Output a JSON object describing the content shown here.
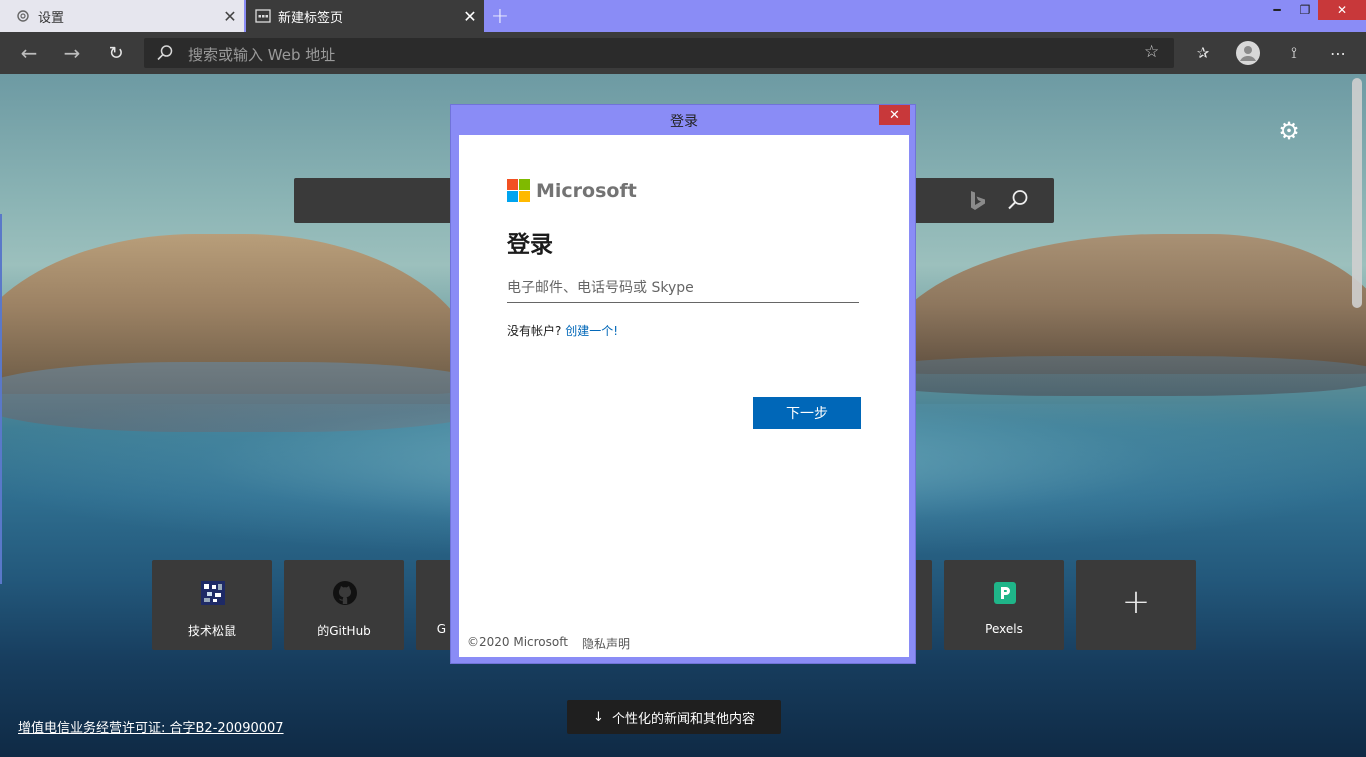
{
  "tabs": [
    {
      "title": "设置",
      "icon": "gear-icon",
      "active": false
    },
    {
      "title": "新建标签页",
      "icon": "newtab-icon",
      "active": true
    }
  ],
  "toolbar": {
    "address_placeholder": "搜索或输入 Web 地址"
  },
  "newtab": {
    "tiles": [
      {
        "label": "技术松鼠",
        "icon": "site-logo-icon"
      },
      {
        "label": "的GitHub",
        "icon": "github-icon"
      },
      {
        "label": "G",
        "icon": ""
      },
      {
        "label": "Pexels",
        "icon": "pexels-icon"
      }
    ],
    "license_text": "增值电信业务经营许可证: 合字B2-20090007",
    "news_button": "个性化的新闻和其他内容"
  },
  "dialog": {
    "title": "登录",
    "brand": "Microsoft",
    "heading": "登录",
    "email_placeholder": "电子邮件、电话号码或 Skype",
    "no_account": "没有帐户?",
    "create_account": "创建一个!",
    "next_button": "下一步",
    "copyright": "©2020 Microsoft",
    "privacy": "隐私声明"
  },
  "colors": {
    "tabstrip": "#8a8cf6",
    "accent": "#0067b8",
    "close_red": "#c8383a",
    "ms_red": "#f25022",
    "ms_green": "#7fba00",
    "ms_blue": "#00a4ef",
    "ms_yellow": "#ffb900"
  }
}
